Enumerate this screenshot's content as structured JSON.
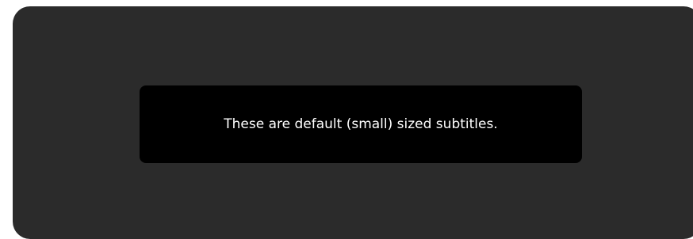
{
  "preview": {
    "background_color": "#2b2b2b",
    "subtitle": {
      "text": "These are default (small) sized subtitles.",
      "text_color": "#ffffff",
      "background_color": "#000000"
    }
  }
}
